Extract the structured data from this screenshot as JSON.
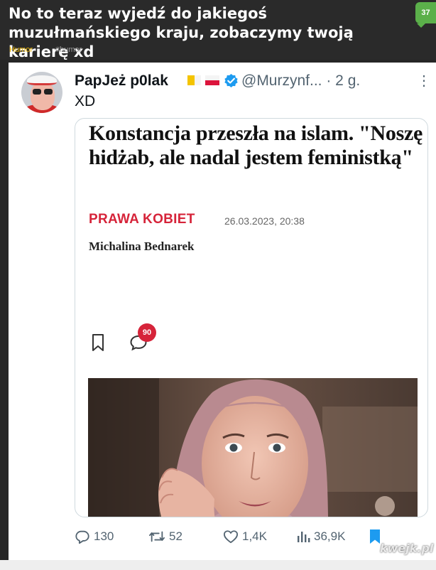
{
  "post": {
    "title": "No to teraz wyjedź do jakiegoś muzułmańskiego kraju, zobaczymy twoją karierę xd",
    "vote_count": "37",
    "categories": [
      "Humor",
      "#humor"
    ]
  },
  "tweet": {
    "display_name": "PapJeż p0lak",
    "handle": "@Murzynf...",
    "time": "· 2 g.",
    "text": "XD",
    "more_label": "⋮",
    "article": {
      "headline": "Konstancja przeszła na islam. \"Noszę hidżab, ale nadal jestem feministką\"",
      "section": "PRAWA KOBIET",
      "date": "26.03.2023, 20:38",
      "author": "Michalina Bednarek",
      "comment_count": "90"
    },
    "actions": {
      "replies": "130",
      "retweets": "52",
      "likes": "1,4K",
      "views": "36,9K"
    }
  },
  "watermark": "kwejk.pl",
  "colors": {
    "background": "#262626",
    "vote_green": "#5bb04a",
    "category_yellow": "#e8b300",
    "section_red": "#d6243a",
    "twitter_blue": "#1d9bf0",
    "muted_text": "#536471"
  },
  "icons": [
    "vatican-flag-icon",
    "poland-flag-icon",
    "verified-badge-icon",
    "more-icon",
    "bookmark-icon",
    "comment-icon",
    "reply-icon",
    "retweet-icon",
    "heart-icon",
    "views-icon",
    "bookmark-filled-icon"
  ]
}
